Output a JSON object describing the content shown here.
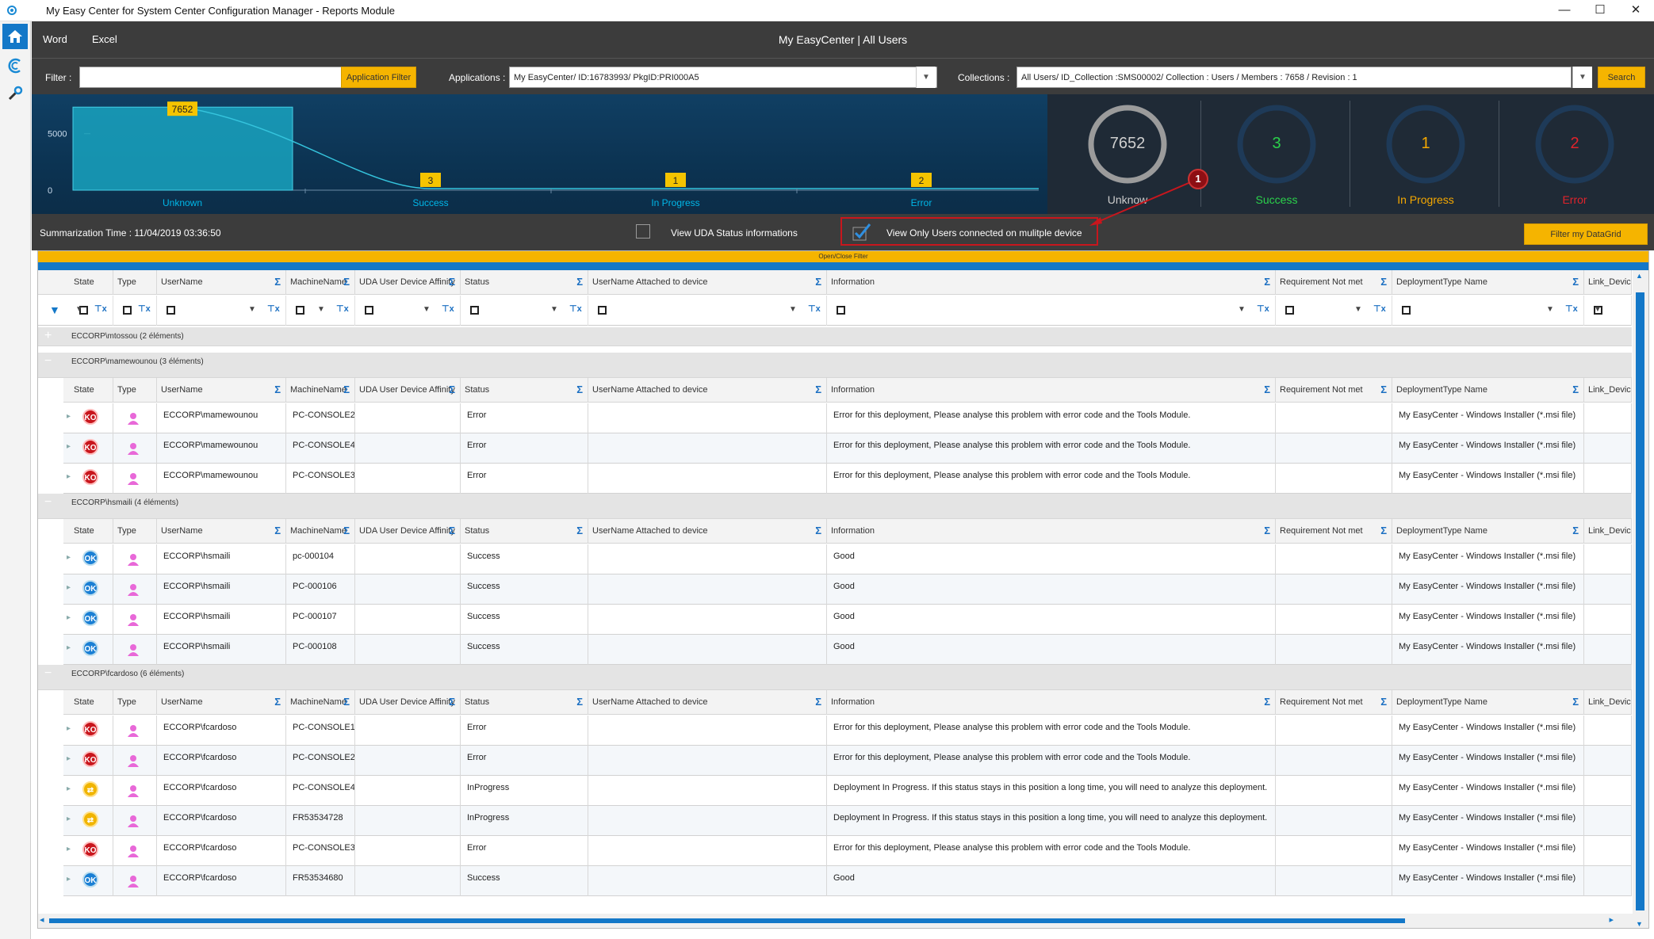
{
  "window": {
    "title": "My Easy Center for System Center Configuration Manager  -  Reports Module",
    "minimize": "—",
    "maximize": "☐",
    "close": "✕"
  },
  "menu": {
    "word": "Word",
    "excel": "Excel",
    "app_title": "My EasyCenter | All Users"
  },
  "filterbar": {
    "filter_label": "Filter :",
    "filter_value": "",
    "application_filter_button": "Application Filter",
    "applications_label": "Applications :",
    "applications_value": "My EasyCenter/ ID:16783993/ PkgID:PRI000A5",
    "collections_label": "Collections :",
    "collections_value": "All Users/ ID_Collection :SMS00002/ Collection : Users / Members : 7658 / Revision : 1",
    "search_button": "Search"
  },
  "chart_data": {
    "type": "area",
    "categories": [
      "Unknown",
      "Success",
      "In Progress",
      "Error"
    ],
    "values": [
      7652,
      3,
      1,
      2
    ],
    "y_ticks": [
      "5000",
      "0"
    ],
    "ylim": [
      0,
      8300
    ],
    "colors": {
      "area": "#19a3bf",
      "line": "#35c4dd",
      "label_bg": "#f5c400",
      "axis_text": "#00b7e8"
    }
  },
  "gauges": [
    {
      "value": "7652",
      "label": "Unknow",
      "color": "#cfcfcf",
      "ring": "#9b9b9b",
      "fraction": 1.0
    },
    {
      "value": "3",
      "label": "Success",
      "color": "#2bd14b",
      "ring": "#1e3a58",
      "fraction": 0.0
    },
    {
      "value": "1",
      "label": "In Progress",
      "color": "#f5a800",
      "ring": "#1e3a58",
      "fraction": 0.0
    },
    {
      "value": "2",
      "label": "Error",
      "color": "#e0232b",
      "ring": "#1e3a58",
      "fraction": 0.0
    }
  ],
  "summary": {
    "time": "Summarization Time : 11/04/2019 03:36:50",
    "uda_label": "View UDA Status informations",
    "uda_checked": false,
    "multi_label": "View Only Users connected on mulitple device",
    "multi_checked": true,
    "filter_button": "Filter my DataGrid",
    "callout_number": "1"
  },
  "grid": {
    "open_close": "Open/Close Filter",
    "columns": [
      "State",
      "Type",
      "UserName",
      "MachineName",
      "UDA User Device Affinity",
      "Status",
      "UserName Attached to device",
      "Information",
      "Requirement Not met",
      "DeploymentType Name",
      "Link_DeviceUser"
    ],
    "groups": [
      {
        "title": "ECCORP\\mtossou (2 éléments)",
        "expanded": false,
        "rows": []
      },
      {
        "title": "ECCORP\\mamewounou (3 éléments)",
        "expanded": true,
        "rows": [
          {
            "state": "KO",
            "user": "ECCORP\\mamewounou",
            "machine": "PC-CONSOLE2",
            "status": "Error",
            "info": "Error for this deployment, Please analyse this problem with error code and the Tools Module.",
            "deploy": "My EasyCenter - Windows Installer (*.msi file)"
          },
          {
            "state": "KO",
            "user": "ECCORP\\mamewounou",
            "machine": "PC-CONSOLE4",
            "status": "Error",
            "info": "Error for this deployment, Please analyse this problem with error code and the Tools Module.",
            "deploy": "My EasyCenter - Windows Installer (*.msi file)"
          },
          {
            "state": "KO",
            "user": "ECCORP\\mamewounou",
            "machine": "PC-CONSOLE3",
            "status": "Error",
            "info": "Error for this deployment, Please analyse this problem with error code and the Tools Module.",
            "deploy": "My EasyCenter - Windows Installer (*.msi file)"
          }
        ]
      },
      {
        "title": "ECCORP\\hsmaili (4 éléments)",
        "expanded": true,
        "rows": [
          {
            "state": "OK",
            "user": "ECCORP\\hsmaili",
            "machine": "pc-000104",
            "status": "Success",
            "info": "Good",
            "deploy": "My EasyCenter - Windows Installer (*.msi file)"
          },
          {
            "state": "OK",
            "user": "ECCORP\\hsmaili",
            "machine": "PC-000106",
            "status": "Success",
            "info": "Good",
            "deploy": "My EasyCenter - Windows Installer (*.msi file)"
          },
          {
            "state": "OK",
            "user": "ECCORP\\hsmaili",
            "machine": "PC-000107",
            "status": "Success",
            "info": "Good",
            "deploy": "My EasyCenter - Windows Installer (*.msi file)"
          },
          {
            "state": "OK",
            "user": "ECCORP\\hsmaili",
            "machine": "PC-000108",
            "status": "Success",
            "info": "Good",
            "deploy": "My EasyCenter - Windows Installer (*.msi file)"
          }
        ]
      },
      {
        "title": "ECCORP\\fcardoso (6 éléments)",
        "expanded": true,
        "rows": [
          {
            "state": "KO",
            "user": "ECCORP\\fcardoso",
            "machine": "PC-CONSOLE1",
            "status": "Error",
            "info": "Error for this deployment, Please analyse this problem with error code and the Tools Module.",
            "deploy": "My EasyCenter - Windows Installer (*.msi file)"
          },
          {
            "state": "KO",
            "user": "ECCORP\\fcardoso",
            "machine": "PC-CONSOLE2",
            "status": "Error",
            "info": "Error for this deployment, Please analyse this problem with error code and the Tools Module.",
            "deploy": "My EasyCenter - Windows Installer (*.msi file)"
          },
          {
            "state": "IP",
            "user": "ECCORP\\fcardoso",
            "machine": "PC-CONSOLE4",
            "status": "InProgress",
            "info": "Deployment In Progress. If this status stays in this position a long time, you will need to analyze this deployment.",
            "deploy": "My EasyCenter - Windows Installer (*.msi file)"
          },
          {
            "state": "IP",
            "user": "ECCORP\\fcardoso",
            "machine": "FR53534728",
            "status": "InProgress",
            "info": "Deployment In Progress. If this status stays in this position a long time, you will need to analyze this deployment.",
            "deploy": "My EasyCenter - Windows Installer (*.msi file)"
          },
          {
            "state": "KO",
            "user": "ECCORP\\fcardoso",
            "machine": "PC-CONSOLE3",
            "status": "Error",
            "info": "Error for this deployment, Please analyse this problem with error code and the Tools Module.",
            "deploy": "My EasyCenter - Windows Installer (*.msi file)"
          },
          {
            "state": "OK",
            "user": "ECCORP\\fcardoso",
            "machine": "FR53534680",
            "status": "Success",
            "info": "Good",
            "deploy": "My EasyCenter - Windows Installer (*.msi file)"
          }
        ]
      }
    ]
  }
}
